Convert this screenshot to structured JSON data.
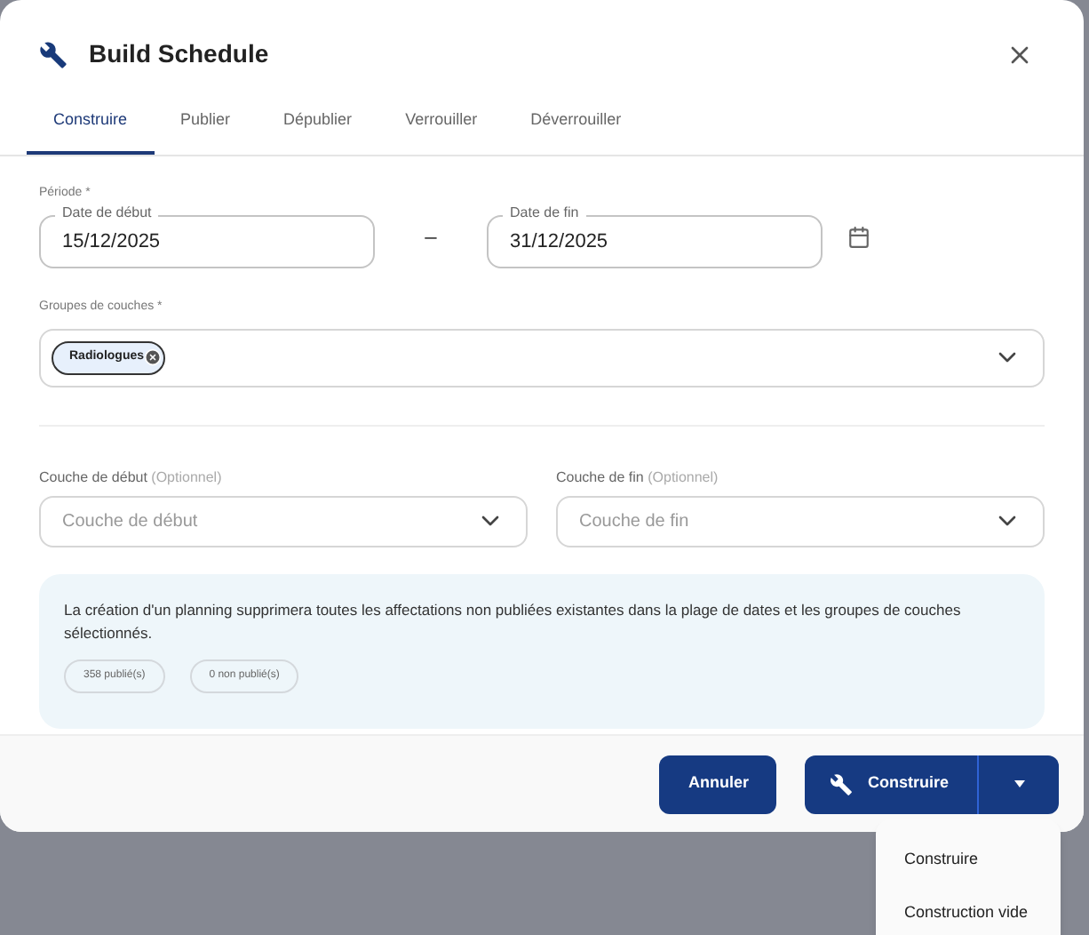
{
  "dialog": {
    "title": "Build Schedule"
  },
  "tabs": [
    {
      "label": "Construire",
      "selected": true
    },
    {
      "label": "Publier",
      "selected": false
    },
    {
      "label": "Dépublier",
      "selected": false
    },
    {
      "label": "Verrouiller",
      "selected": false
    },
    {
      "label": "Déverrouiller",
      "selected": false
    }
  ],
  "period": {
    "label": "Période *",
    "start": {
      "label": "Date de début",
      "value": "15/12/2025"
    },
    "separator": "–",
    "end": {
      "label": "Date de fin",
      "value": "31/12/2025"
    }
  },
  "groups": {
    "label": "Groupes de couches *",
    "chips": [
      "Radiologues"
    ]
  },
  "start_layer": {
    "label": "Couche de début",
    "hint": "(Optionnel)",
    "placeholder": "Couche de début"
  },
  "end_layer": {
    "label": "Couche de fin",
    "hint": "(Optionnel)",
    "placeholder": "Couche de fin"
  },
  "notice": {
    "text": "La création d'un planning supprimera toutes les affectations non publiées existantes dans la plage de dates et les groupes de couches sélectionnés.",
    "badges": [
      "358 publié(s)",
      "0 non publié(s)"
    ]
  },
  "buttons": {
    "cancel": "Annuler",
    "build": "Construire"
  },
  "menu": {
    "items": [
      "Construire",
      "Construction vide"
    ]
  }
}
